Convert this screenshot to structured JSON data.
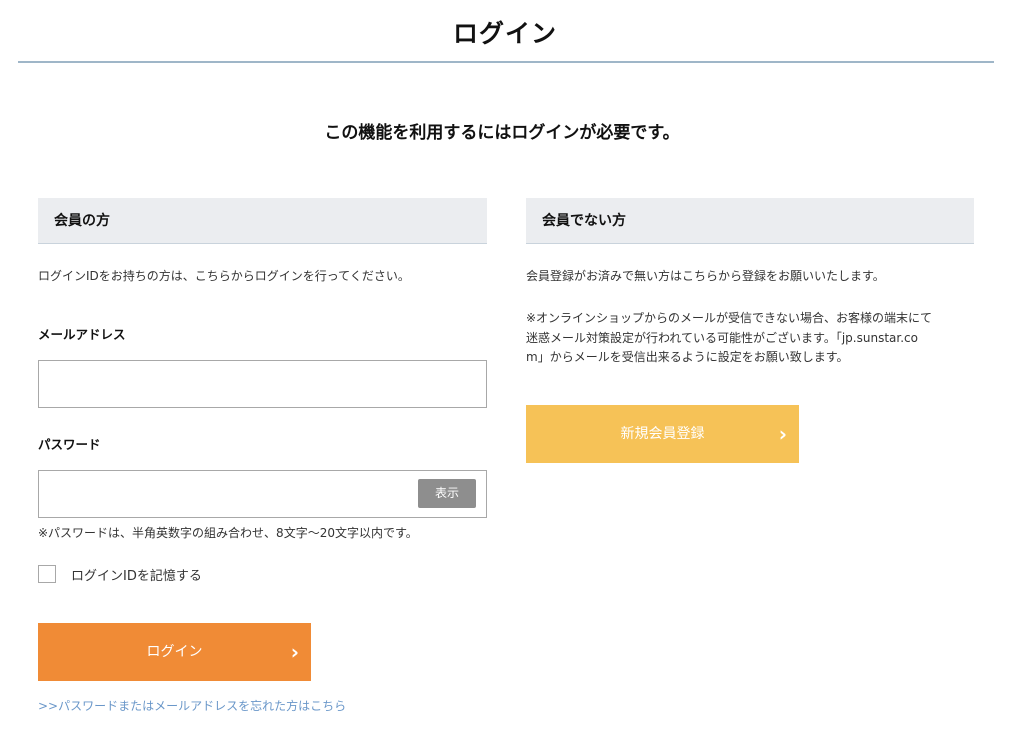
{
  "page": {
    "title": "ログイン",
    "notice": "この機能を利用するにはログインが必要です。"
  },
  "member": {
    "header": "会員の方",
    "description": "ログインIDをお持ちの方は、こちらからログインを行ってください。",
    "email_label": "メールアドレス",
    "email_value": "",
    "password_label": "パスワード",
    "password_value": "",
    "show_button": "表示",
    "password_hint": "※パスワードは、半角英数字の組み合わせ、8文字〜20文字以内です。",
    "remember_label": "ログインIDを記憶する",
    "remember_checked": false,
    "login_button": "ログイン",
    "forgot_link": ">>パスワードまたはメールアドレスを忘れた方はこちら"
  },
  "nonmember": {
    "header": "会員でない方",
    "description": "会員登録がお済みで無い方はこちらから登録をお願いいたします。",
    "note_line1": "※オンラインショップからのメールが受信できない場合、お客様の端末にて",
    "note_line2": "迷惑メール対策設定が行われている可能性がございます。「jp.sunstar.co",
    "note_line3": "m」からメールを受信出来るように設定をお願い致します。",
    "register_button": "新規会員登録"
  },
  "icons": {
    "login_chevron": "chevron-right-icon",
    "register_chevron": "chevron-right-icon",
    "chevron_glyph": "›"
  },
  "colors": {
    "login_button": "#f08b36",
    "register_button": "#f6c257",
    "title_rule": "#9fb6c8",
    "link": "#6a97c9",
    "section_header_bg": "#ebedf0"
  }
}
